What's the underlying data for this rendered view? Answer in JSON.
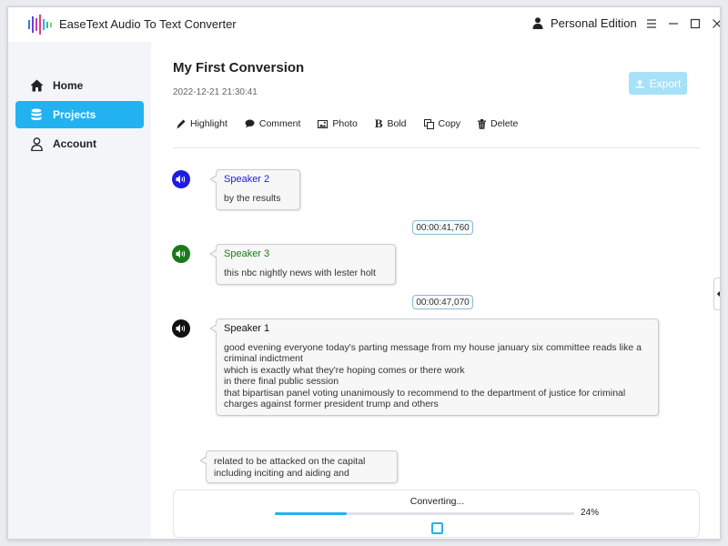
{
  "titlebar": {
    "app_icon": "waveform-logo-icon",
    "app_title": "EaseText Audio To Text Converter",
    "edition": "Personal Edition",
    "edition_icon": "user-icon",
    "controls": [
      "menu-icon",
      "minimize-icon",
      "maximize-icon",
      "close-icon"
    ]
  },
  "sidebar": {
    "items": [
      {
        "label": "Home",
        "icon": "home-icon",
        "active": false
      },
      {
        "label": "Projects",
        "icon": "database-icon",
        "active": true
      },
      {
        "label": "Account",
        "icon": "user-outline-icon",
        "active": false
      }
    ]
  },
  "document": {
    "title": "My First Conversion",
    "date": "2022-12-21 21:30:41",
    "export_label": "Export"
  },
  "toolbar": {
    "highlight": "Highlight",
    "comment": "Comment",
    "photo": "Photo",
    "bold": "Bold",
    "copy": "Copy",
    "delete": "Delete"
  },
  "transcript": {
    "segments": [
      {
        "speaker": "Speaker 2",
        "color": "#1d1de0",
        "lines": [
          "by the results"
        ]
      },
      {
        "timestamp": "00:00:41,760",
        "speaker": "Speaker 3",
        "color": "#1a7a1a",
        "lines": [
          "this nbc nightly news with lester holt"
        ]
      },
      {
        "timestamp": "00:00:47,070",
        "speaker": "Speaker 1",
        "color": "#111111",
        "lines": [
          "good evening everyone today's parting message from my house january six committee reads like a criminal indictment",
          "which is exactly what they're hoping comes or there work",
          "in there final public session",
          "that bipartisan panel voting unanimously to recommend to the department of justice for criminal charges against former president trump and others"
        ]
      },
      {
        "lines": [
          "related to be attacked on the capital",
          "including inciting and aiding and"
        ]
      }
    ]
  },
  "progress": {
    "label": "Converting...",
    "percent_label": "24%",
    "percent": 0.24
  },
  "colors": {
    "accent": "#22b2ef",
    "export_disabled": "#a6e1f8",
    "sidebar_bg": "#f3f5f8"
  }
}
